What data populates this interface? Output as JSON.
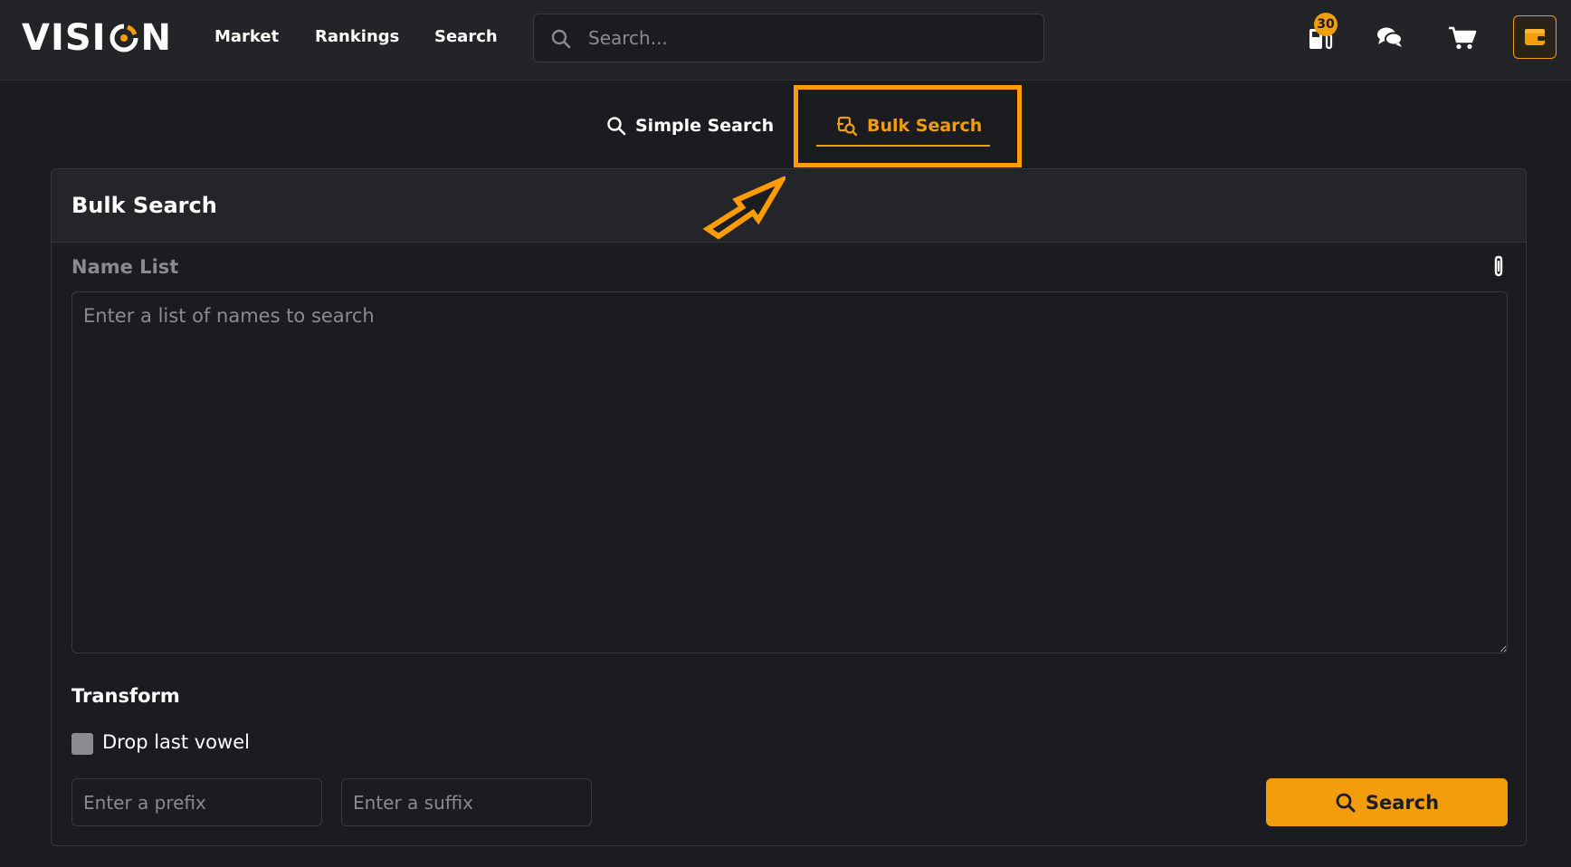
{
  "header": {
    "logo_text": "VISION",
    "nav": [
      "Market",
      "Rankings",
      "Search"
    ],
    "search_placeholder": "Search...",
    "notification_count": "30"
  },
  "tabs": {
    "simple_label": "Simple Search",
    "bulk_label": "Bulk Search",
    "active": "Bulk Search"
  },
  "panel": {
    "title": "Bulk Search",
    "name_list_label": "Name List",
    "name_list_placeholder": "Enter a list of names to search",
    "transform_label": "Transform",
    "drop_last_vowel_label": "Drop last vowel",
    "drop_last_vowel_checked": false,
    "prefix_placeholder": "Enter a prefix",
    "suffix_placeholder": "Enter a suffix",
    "search_button_label": "Search"
  },
  "colors": {
    "accent": "#f29d0b",
    "highlight": "#ff9d00",
    "background": "#1b1c20",
    "header": "#232428"
  },
  "icons": [
    "search-icon",
    "gas-pump-icon",
    "chat-icon",
    "cart-icon",
    "wallet-icon",
    "paperclip-icon",
    "bulk-search-icon",
    "arrow-annotation-icon"
  ]
}
